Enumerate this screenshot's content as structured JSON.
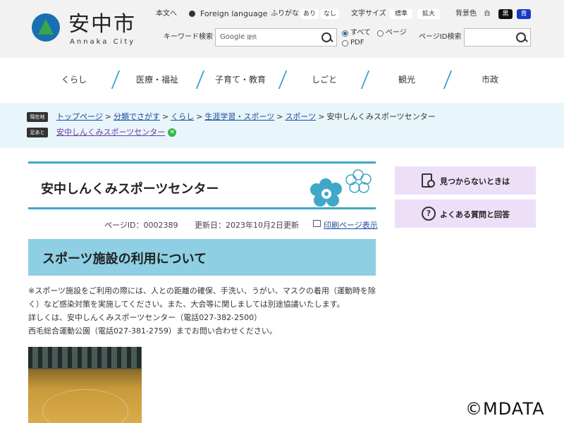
{
  "header": {
    "logo_title": "安中市",
    "logo_sub": "Annaka City",
    "skip_link": "本文へ",
    "foreign_language": "Foreign language",
    "furigana_label": "ふりがな",
    "furigana_on": "あり",
    "furigana_off": "なし",
    "text_size_label": "文字サイズ",
    "text_size_standard": "標準",
    "text_size_large": "拡大",
    "bg_color_label": "背景色",
    "bg_white": "白",
    "bg_black": "黒",
    "bg_blue": "青",
    "keyword_search_label": "キーワード検索",
    "google_label": "Google",
    "google_provided": "提供",
    "search_options": [
      "すべて",
      "ページ",
      "PDF"
    ],
    "page_id_search_label": "ページID検索"
  },
  "nav": {
    "items": [
      "くらし",
      "医療・福祉",
      "子育て・教育",
      "しごと",
      "観光",
      "市政"
    ]
  },
  "breadcrumb": {
    "current_tag": "現在地",
    "trail": [
      "トップページ",
      "分類でさがす",
      "くらし",
      "生涯学習・スポーツ",
      "スポーツ"
    ],
    "current": "安中しんくみスポーツセンター",
    "history_tag": "足あと",
    "history_item": "安中しんくみスポーツセンター",
    "separator": ">"
  },
  "main": {
    "title": "安中しんくみスポーツセンター",
    "page_id": "ページID：0002389",
    "updated": "更新日：2023年10月2日更新",
    "print_link": "印刷ページ表示",
    "section_heading": "スポーツ施設の利用について",
    "paragraph_lines": [
      "※スポーツ施設をご利用の際には、人との距離の確保、手洗い、うがい、マスクの着用（運動時を除",
      "く）など感染対策を実施してください。また、大会等に関しましては別途協議いたします。",
      "詳しくは、安中しんくみスポーツセンター（電話027-382-2500）",
      "西毛総合運動公園（電話027-381-2759）までお問い合わせください。"
    ]
  },
  "sidebar": {
    "not_found": "見つからないときは",
    "faq": "よくある質問と回答"
  },
  "watermark": "©MDATA",
  "colors": {
    "accent": "#3fa7c8",
    "section_bg": "#8ecfe3",
    "sidebar_bg": "#ecdff7",
    "crumb_bg": "#e8f6fb"
  }
}
